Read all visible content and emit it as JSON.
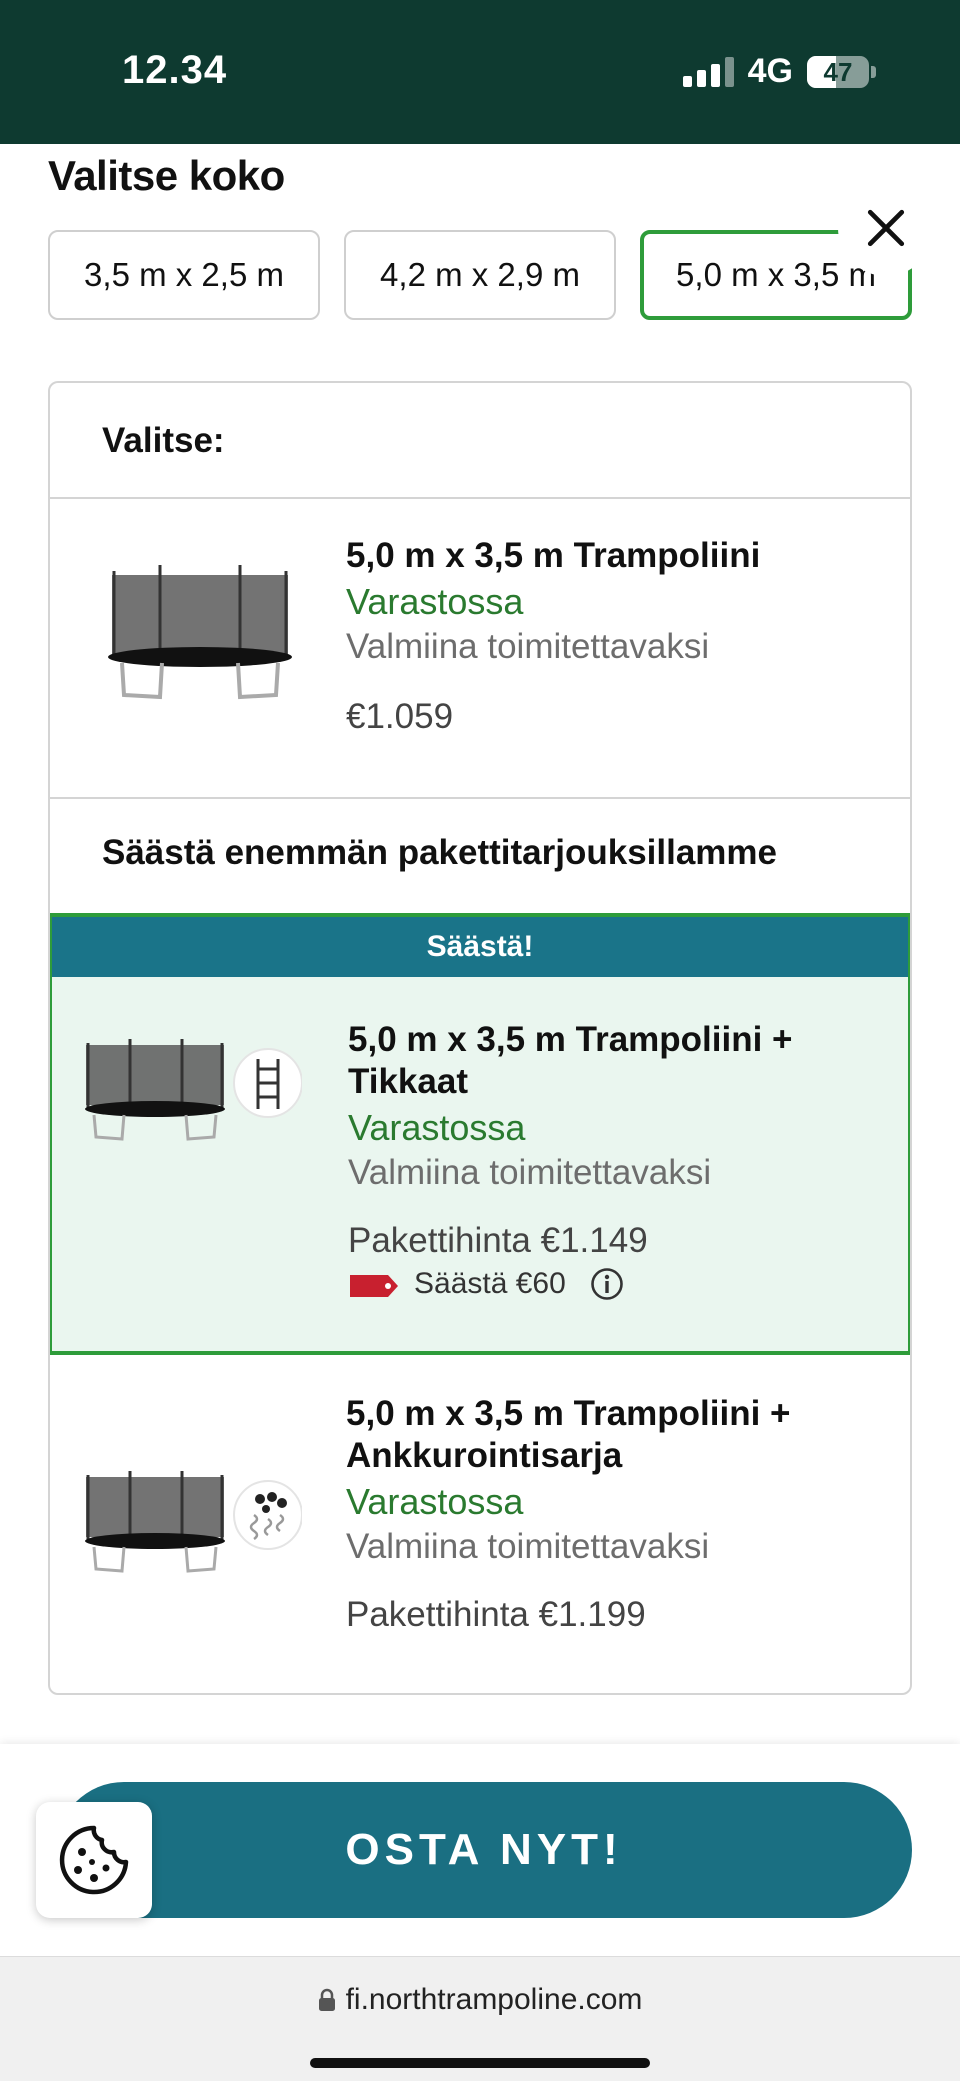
{
  "status_bar": {
    "time": "12.34",
    "network": "4G",
    "battery": "47",
    "battery_level": 0.47
  },
  "size_picker": {
    "title": "Valitse koko",
    "options": [
      "3,5 m x 2,5 m",
      "4,2 m x 2,9 m",
      "5,0 m x 3,5 m"
    ],
    "selected": "5,0 m x 3,5 m"
  },
  "card": {
    "header": "Valitse:",
    "main_product": {
      "title": "5,0 m x 3,5 m Trampoliini",
      "stock": "Varastossa",
      "availability": "Valmiina toimitettavaksi",
      "price": "€1.059"
    },
    "bundles_heading": "Säästä enemmän pakettitarjouksillamme",
    "bundles": [
      {
        "banner": "Säästä!",
        "title": "5,0 m x 3,5 m Trampoliini + Tikkaat",
        "stock": "Varastossa",
        "availability": "Valmiina toimitettavaksi",
        "price": "Pakettihinta €1.149",
        "savings": "Säästä €60"
      },
      {
        "title": "5,0 m x 3,5 m Trampoliini + Ankkurointisarja",
        "stock": "Varastossa",
        "availability": "Valmiina toimitettavaksi",
        "price": "Pakettihinta €1.199"
      }
    ]
  },
  "buy_button": "OSTA NYT!",
  "browser": {
    "url": "fi.northtrampoline.com"
  },
  "colors": {
    "status_bar_bg": "#0e3a30",
    "selected_border": "#2e9c3a",
    "stock_green": "#2a7a2f",
    "deal_banner": "#1a7489",
    "deal_bg": "#eaf6ef",
    "buy_button": "#1a6f82",
    "savings_tag": "#c8202f"
  },
  "icons": [
    "close-icon",
    "trampoline-image",
    "ladder-image",
    "anchor-kit-image",
    "price-tag-icon",
    "info-icon",
    "cookie-icon",
    "lock-icon"
  ]
}
